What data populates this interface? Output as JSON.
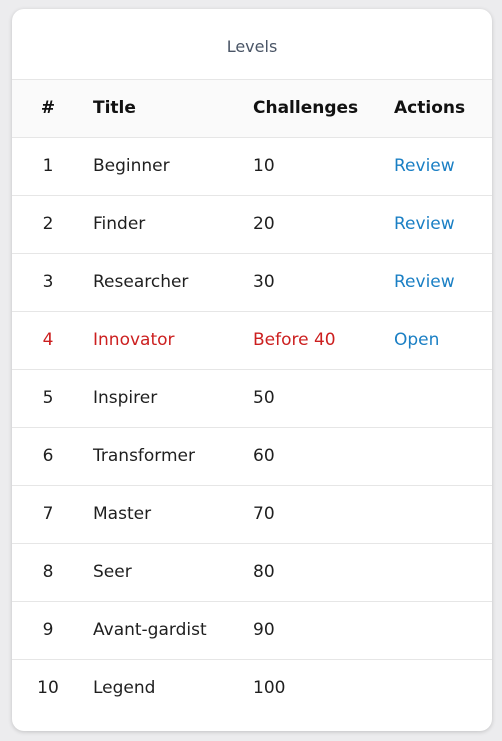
{
  "card": {
    "title": "Levels"
  },
  "table": {
    "headers": {
      "num": "#",
      "title": "Title",
      "challenges": "Challenges",
      "actions": "Actions"
    },
    "rows": [
      {
        "num": "1",
        "title": "Beginner",
        "challenges": "10",
        "action": "Review"
      },
      {
        "num": "2",
        "title": "Finder",
        "challenges": "20",
        "action": "Review"
      },
      {
        "num": "3",
        "title": "Researcher",
        "challenges": "30",
        "action": "Review"
      },
      {
        "num": "4",
        "title": "Innovator",
        "challenges": "Before 40",
        "action": "Open"
      },
      {
        "num": "5",
        "title": "Inspirer",
        "challenges": "50",
        "action": ""
      },
      {
        "num": "6",
        "title": "Transformer",
        "challenges": "60",
        "action": ""
      },
      {
        "num": "7",
        "title": "Master",
        "challenges": "70",
        "action": ""
      },
      {
        "num": "8",
        "title": "Seer",
        "challenges": "80",
        "action": ""
      },
      {
        "num": "9",
        "title": "Avant-gardist",
        "challenges": "90",
        "action": ""
      },
      {
        "num": "10",
        "title": "Legend",
        "challenges": "100",
        "action": ""
      }
    ]
  },
  "colors": {
    "current_level": "#cc1f1f",
    "link": "#1a7fc4"
  }
}
